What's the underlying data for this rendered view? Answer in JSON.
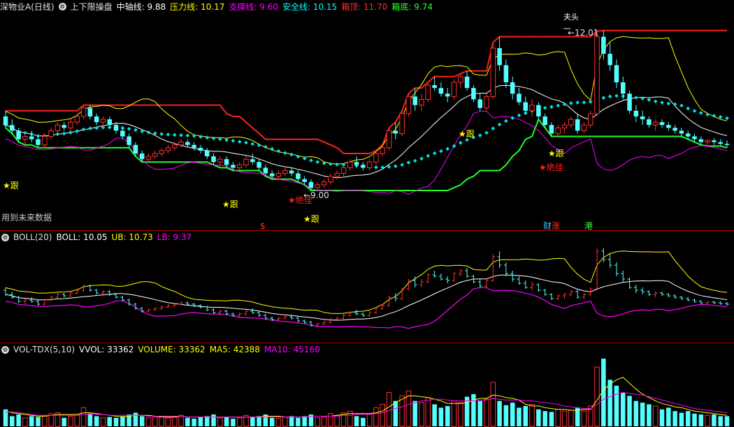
{
  "main_header": {
    "stock": "深物业A(日线)",
    "indicator": "上下限操盘",
    "items": [
      {
        "label": "中轴线:",
        "value": "9.88",
        "color": "#ffffff"
      },
      {
        "label": "压力线:",
        "value": "10.17",
        "color": "#ffff00"
      },
      {
        "label": "支撑线:",
        "value": "9.60",
        "color": "#ff00ff"
      },
      {
        "label": "安全线:",
        "value": "10.15",
        "color": "#00ffff"
      },
      {
        "label": "箱顶:",
        "value": "11.70",
        "color": "#ff3030"
      },
      {
        "label": "箱底:",
        "value": "9.74",
        "color": "#33ff33"
      }
    ]
  },
  "main_chart": {
    "notice": "用到未来数据",
    "high_label": "12.01",
    "low_label": "9.00",
    "top_mark": "夫头",
    "signals": [
      {
        "text": "★跟",
        "color": "#ffff00"
      },
      {
        "text": "★跟",
        "color": "#ffff00"
      },
      {
        "text": "★绝佳",
        "color": "#ff2020"
      },
      {
        "text": "★跟",
        "color": "#ffff00"
      },
      {
        "text": "★跟",
        "color": "#ffff00"
      },
      {
        "text": "★跟",
        "color": "#ffff00"
      },
      {
        "text": "★绝佳",
        "color": "#ff2020"
      }
    ],
    "bottom_markers": [
      {
        "text": "$",
        "color": "#ff3030"
      },
      {
        "text": "财",
        "color": "#40c0ff"
      },
      {
        "text": "涨",
        "color": "#ff3030"
      },
      {
        "text": "港",
        "color": "#40ff40"
      }
    ]
  },
  "boll_header": {
    "name": "BOLL(20)",
    "items": [
      {
        "label": "BOLL:",
        "value": "10.05",
        "color": "#ffffff"
      },
      {
        "label": "UB:",
        "value": "10.73",
        "color": "#ffff00"
      },
      {
        "label": "LB:",
        "value": "9.37",
        "color": "#ff00ff"
      }
    ]
  },
  "vol_header": {
    "name": "VOL-TDX(5,10)",
    "items": [
      {
        "label": "VVOL:",
        "value": "33362",
        "color": "#ffffff"
      },
      {
        "label": "VOLUME:",
        "value": "33362",
        "color": "#ffff00"
      },
      {
        "label": "MA5:",
        "value": "42388",
        "color": "#ffff00"
      },
      {
        "label": "MA10:",
        "value": "45160",
        "color": "#ff00ff"
      }
    ]
  },
  "colors": {
    "up": "#ff3232",
    "down": "#54ffff",
    "mid": "#ffffff",
    "upper": "#ffff00",
    "lower": "#ff00ff",
    "box_top": "#ff2020",
    "box_bottom": "#20ff20",
    "safe": "#00e0e0",
    "grid": "#7a0000"
  },
  "chart_data": {
    "type": "candlestick",
    "title": "深物业A(日线)",
    "candles": [
      [
        10.5,
        10.6,
        10.3,
        10.35
      ],
      [
        10.35,
        10.45,
        10.2,
        10.25
      ],
      [
        10.25,
        10.3,
        10.05,
        10.1
      ],
      [
        10.1,
        10.2,
        10.0,
        10.15
      ],
      [
        10.15,
        10.25,
        10.05,
        10.1
      ],
      [
        10.1,
        10.15,
        9.95,
        10.0
      ],
      [
        10.0,
        10.2,
        9.95,
        10.15
      ],
      [
        10.15,
        10.3,
        10.1,
        10.25
      ],
      [
        10.25,
        10.4,
        10.2,
        10.35
      ],
      [
        10.35,
        10.4,
        10.25,
        10.3
      ],
      [
        10.3,
        10.45,
        10.25,
        10.4
      ],
      [
        10.4,
        10.55,
        10.35,
        10.5
      ],
      [
        10.5,
        10.7,
        10.45,
        10.65
      ],
      [
        10.65,
        10.7,
        10.45,
        10.5
      ],
      [
        10.5,
        10.55,
        10.35,
        10.4
      ],
      [
        10.4,
        10.5,
        10.3,
        10.45
      ],
      [
        10.45,
        10.5,
        10.3,
        10.35
      ],
      [
        10.35,
        10.4,
        10.2,
        10.25
      ],
      [
        10.25,
        10.3,
        10.1,
        10.15
      ],
      [
        10.15,
        10.2,
        9.95,
        10.0
      ],
      [
        10.0,
        10.05,
        9.8,
        9.85
      ],
      [
        9.85,
        9.9,
        9.7,
        9.75
      ],
      [
        9.75,
        9.85,
        9.7,
        9.8
      ],
      [
        9.8,
        9.9,
        9.75,
        9.85
      ],
      [
        9.85,
        9.95,
        9.8,
        9.9
      ],
      [
        9.9,
        10.0,
        9.85,
        9.95
      ],
      [
        9.95,
        10.05,
        9.9,
        10.0
      ],
      [
        10.0,
        10.1,
        9.95,
        10.05
      ],
      [
        10.05,
        10.1,
        9.95,
        10.0
      ],
      [
        10.0,
        10.05,
        9.9,
        9.95
      ],
      [
        9.95,
        10.0,
        9.85,
        9.9
      ],
      [
        9.9,
        9.95,
        9.75,
        9.8
      ],
      [
        9.8,
        9.85,
        9.65,
        9.7
      ],
      [
        9.7,
        9.8,
        9.6,
        9.75
      ],
      [
        9.75,
        9.8,
        9.6,
        9.65
      ],
      [
        9.65,
        9.7,
        9.55,
        9.6
      ],
      [
        9.6,
        9.7,
        9.55,
        9.65
      ],
      [
        9.65,
        9.8,
        9.6,
        9.75
      ],
      [
        9.75,
        9.85,
        9.65,
        9.7
      ],
      [
        9.7,
        9.75,
        9.55,
        9.6
      ],
      [
        9.6,
        9.65,
        9.45,
        9.5
      ],
      [
        9.5,
        9.55,
        9.4,
        9.45
      ],
      [
        9.45,
        9.55,
        9.4,
        9.5
      ],
      [
        9.5,
        9.6,
        9.45,
        9.55
      ],
      [
        9.55,
        9.6,
        9.45,
        9.5
      ],
      [
        9.5,
        9.55,
        9.35,
        9.4
      ],
      [
        9.4,
        9.45,
        9.3,
        9.35
      ],
      [
        9.35,
        9.4,
        9.2,
        9.25
      ],
      [
        9.25,
        9.35,
        9.2,
        9.3
      ],
      [
        9.3,
        9.4,
        9.25,
        9.35
      ],
      [
        9.35,
        9.5,
        9.3,
        9.45
      ],
      [
        9.45,
        9.55,
        9.4,
        9.5
      ],
      [
        9.5,
        9.65,
        9.45,
        9.6
      ],
      [
        9.6,
        9.75,
        9.55,
        9.7
      ],
      [
        9.7,
        9.8,
        9.6,
        9.65
      ],
      [
        9.65,
        9.7,
        9.55,
        9.6
      ],
      [
        9.6,
        9.75,
        9.55,
        9.7
      ],
      [
        9.7,
        9.9,
        9.65,
        9.85
      ],
      [
        9.85,
        10.0,
        9.8,
        9.95
      ],
      [
        9.95,
        10.3,
        9.9,
        10.25
      ],
      [
        10.25,
        10.4,
        10.1,
        10.2
      ],
      [
        10.2,
        10.6,
        10.15,
        10.55
      ],
      [
        10.55,
        10.9,
        10.5,
        10.85
      ],
      [
        10.85,
        11.0,
        10.6,
        10.7
      ],
      [
        10.7,
        10.9,
        10.6,
        10.8
      ],
      [
        10.8,
        11.1,
        10.75,
        11.05
      ],
      [
        11.05,
        11.2,
        10.95,
        11.0
      ],
      [
        11.0,
        11.1,
        10.85,
        10.9
      ],
      [
        10.9,
        11.0,
        10.75,
        10.85
      ],
      [
        10.85,
        11.15,
        10.8,
        11.1
      ],
      [
        11.1,
        11.25,
        11.0,
        11.2
      ],
      [
        11.2,
        11.3,
        10.95,
        11.0
      ],
      [
        11.0,
        11.05,
        10.75,
        10.8
      ],
      [
        10.8,
        10.9,
        10.6,
        10.65
      ],
      [
        10.65,
        10.9,
        10.6,
        10.85
      ],
      [
        10.85,
        11.8,
        10.8,
        11.7
      ],
      [
        11.7,
        11.9,
        11.3,
        11.4
      ],
      [
        11.4,
        11.5,
        11.0,
        11.1
      ],
      [
        11.1,
        11.2,
        10.8,
        10.9
      ],
      [
        10.9,
        11.0,
        10.7,
        10.75
      ],
      [
        10.75,
        10.85,
        10.55,
        10.6
      ],
      [
        10.6,
        10.8,
        10.5,
        10.7
      ],
      [
        10.7,
        10.75,
        10.45,
        10.5
      ],
      [
        10.5,
        10.55,
        10.3,
        10.35
      ],
      [
        10.35,
        10.4,
        10.15,
        10.2
      ],
      [
        10.2,
        10.35,
        10.15,
        10.3
      ],
      [
        10.3,
        10.4,
        10.2,
        10.35
      ],
      [
        10.35,
        10.5,
        10.3,
        10.45
      ],
      [
        10.45,
        10.55,
        10.2,
        10.25
      ],
      [
        10.25,
        10.4,
        10.2,
        10.35
      ],
      [
        10.35,
        10.6,
        10.3,
        10.55
      ],
      [
        10.55,
        12.0,
        10.5,
        11.9
      ],
      [
        11.9,
        12.01,
        11.5,
        11.6
      ],
      [
        11.6,
        11.8,
        11.3,
        11.4
      ],
      [
        11.4,
        11.5,
        11.0,
        11.1
      ],
      [
        11.1,
        11.2,
        10.8,
        10.9
      ],
      [
        10.9,
        10.95,
        10.55,
        10.6
      ],
      [
        10.6,
        10.7,
        10.4,
        10.5
      ],
      [
        10.5,
        10.6,
        10.35,
        10.45
      ],
      [
        10.45,
        10.5,
        10.3,
        10.35
      ],
      [
        10.35,
        10.45,
        10.25,
        10.4
      ],
      [
        10.4,
        10.45,
        10.3,
        10.35
      ],
      [
        10.35,
        10.4,
        10.25,
        10.3
      ],
      [
        10.3,
        10.35,
        10.2,
        10.25
      ],
      [
        10.25,
        10.3,
        10.15,
        10.2
      ],
      [
        10.2,
        10.25,
        10.1,
        10.15
      ],
      [
        10.15,
        10.2,
        10.05,
        10.1
      ],
      [
        10.1,
        10.15,
        10.0,
        10.05
      ],
      [
        10.05,
        10.1,
        9.98,
        10.08
      ],
      [
        10.08,
        10.12,
        10.0,
        10.05
      ],
      [
        10.05,
        10.1,
        9.98,
        10.02
      ],
      [
        10.02,
        10.08,
        9.95,
        10.0
      ]
    ],
    "volume": [
      20,
      12,
      14,
      10,
      12,
      11,
      13,
      15,
      16,
      10,
      12,
      14,
      22,
      15,
      12,
      10,
      11,
      10,
      12,
      14,
      16,
      12,
      10,
      11,
      12,
      10,
      11,
      13,
      10,
      9,
      11,
      12,
      14,
      10,
      11,
      9,
      10,
      13,
      11,
      12,
      14,
      10,
      9,
      11,
      12,
      10,
      12,
      14,
      10,
      11,
      15,
      13,
      16,
      18,
      12,
      10,
      14,
      22,
      26,
      40,
      30,
      36,
      42,
      30,
      28,
      34,
      26,
      22,
      24,
      30,
      28,
      35,
      38,
      30,
      32,
      52,
      30,
      25,
      28,
      22,
      24,
      26,
      20,
      18,
      17,
      20,
      18,
      19,
      22,
      18,
      24,
      70,
      80,
      55,
      48,
      40,
      36,
      30,
      28,
      26,
      24,
      20,
      22,
      18,
      16,
      18,
      15,
      14,
      13,
      14,
      12,
      12
    ],
    "volume_ma5": [
      18,
      16,
      15,
      14,
      13,
      12,
      12,
      13,
      14,
      14,
      14,
      14,
      16,
      16,
      15,
      14,
      13,
      12,
      11,
      12,
      13,
      13,
      13,
      12,
      11,
      11,
      11,
      12,
      11,
      11,
      11,
      11,
      11,
      11,
      11,
      11,
      11,
      11,
      11,
      11,
      12,
      12,
      12,
      11,
      11,
      11,
      11,
      12,
      12,
      12,
      12,
      13,
      14,
      15,
      15,
      15,
      15,
      16,
      18,
      23,
      28,
      32,
      36,
      36,
      35,
      34,
      32,
      30,
      27,
      27,
      27,
      28,
      31,
      33,
      33,
      37,
      36,
      34,
      33,
      31,
      26,
      24,
      24,
      22,
      21,
      20,
      20,
      19,
      19,
      20,
      20,
      31,
      43,
      50,
      55,
      58,
      51,
      44,
      38,
      34,
      30,
      27,
      25,
      23,
      22,
      20,
      18,
      17,
      16,
      15,
      14,
      13
    ],
    "volume_ma10": [
      17,
      17,
      16,
      15,
      14,
      13,
      13,
      13,
      13,
      13,
      13,
      13,
      14,
      14,
      14,
      14,
      13,
      13,
      13,
      13,
      13,
      13,
      12,
      12,
      12,
      12,
      12,
      12,
      11,
      11,
      11,
      11,
      11,
      11,
      11,
      11,
      11,
      11,
      11,
      11,
      11,
      11,
      11,
      11,
      11,
      11,
      11,
      12,
      12,
      12,
      12,
      12,
      13,
      13,
      14,
      14,
      14,
      15,
      16,
      19,
      21,
      23,
      26,
      28,
      30,
      31,
      32,
      32,
      31,
      30,
      30,
      30,
      30,
      31,
      31,
      33,
      32,
      31,
      31,
      31,
      30,
      30,
      29,
      28,
      27,
      26,
      24,
      23,
      22,
      21,
      21,
      26,
      32,
      35,
      38,
      40,
      39,
      38,
      37,
      35,
      33,
      31,
      29,
      27,
      25,
      23,
      21,
      20,
      19,
      18,
      17,
      16
    ]
  }
}
